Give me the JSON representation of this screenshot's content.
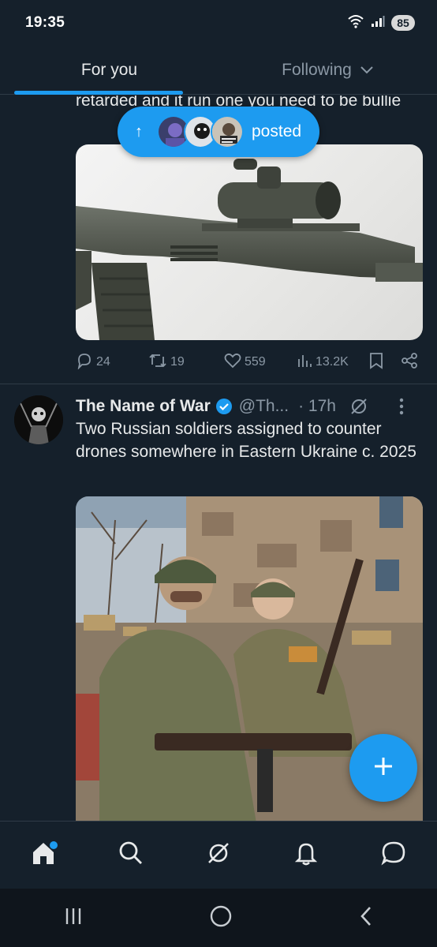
{
  "status_bar": {
    "time": "19:35",
    "battery": "85"
  },
  "tabs": [
    {
      "label": "For you",
      "active": true
    },
    {
      "label": "Following",
      "active": false
    }
  ],
  "previous_post": {
    "text": "retarded and it run one you need to be bullie",
    "actions": {
      "replies": "24",
      "reposts": "19",
      "likes": "559",
      "views": "13.2K"
    }
  },
  "posted_pill": {
    "label": "posted"
  },
  "post": {
    "author_name": "The Name of War",
    "handle": "@Th...",
    "time": "· 17h",
    "text": "Two Russian soldiers assigned to counter drones somewhere in Eastern Ukraine c. 2025"
  },
  "colors": {
    "accent": "#1d9bf0",
    "background": "#15202b",
    "secondary_text": "#8b98a5"
  },
  "icons": [
    "home-icon",
    "search-icon",
    "grok-icon",
    "notifications-icon",
    "messages-icon",
    "compose-icon"
  ]
}
